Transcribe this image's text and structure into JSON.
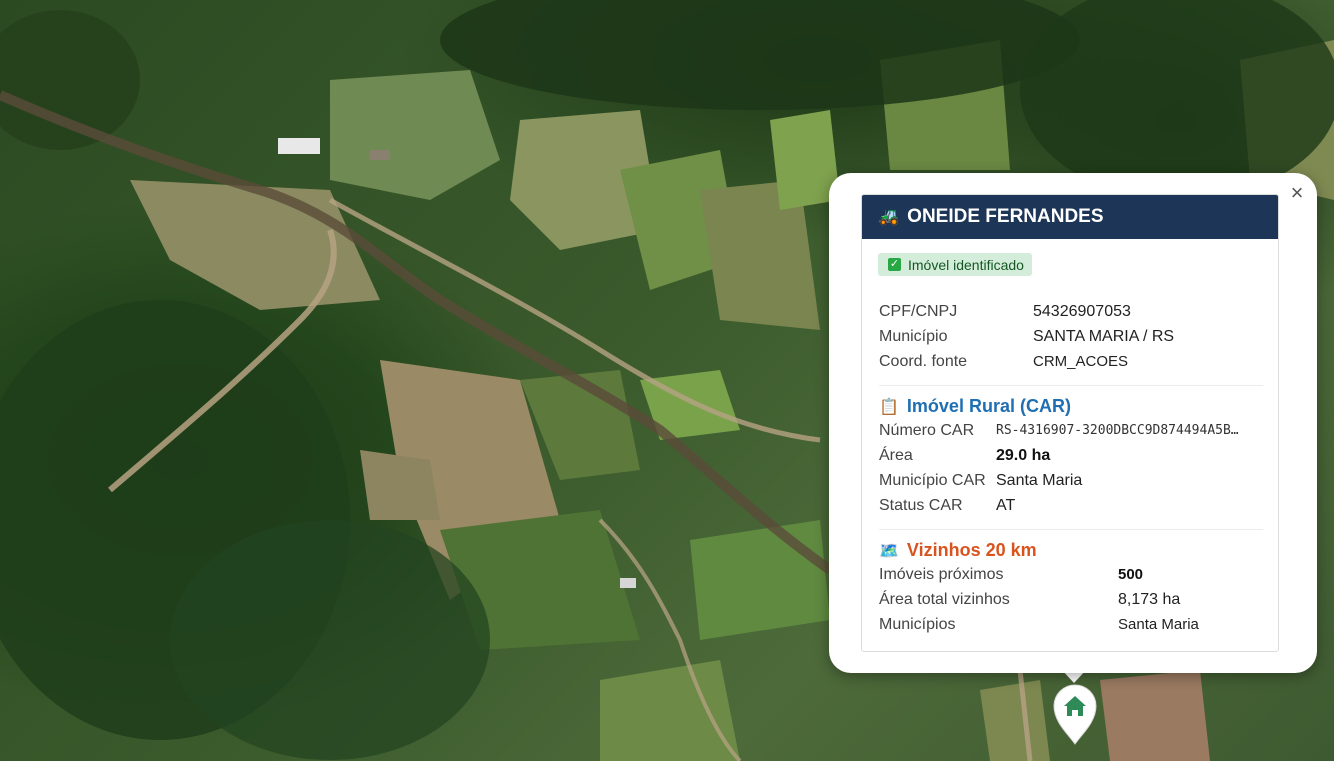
{
  "map": {
    "type": "satellite"
  },
  "popup": {
    "close_label": "×",
    "title": "ONEIDE FERNANDES",
    "title_icon": "tractor-icon",
    "badge": "Imóvel identificado",
    "owner": {
      "cpf_label": "CPF/CNPJ",
      "cpf_value": "54326907053",
      "municipio_label": "Município",
      "municipio_value": "SANTA MARIA / RS",
      "coord_label": "Coord. fonte",
      "coord_value": "CRM_ACOES"
    },
    "car": {
      "title": "Imóvel Rural (CAR)",
      "icon": "clipboard-icon",
      "numero_label": "Número CAR",
      "numero_value": "RS-4316907-3200DBCC9D874494A5B…",
      "area_label": "Área",
      "area_value": "29.0 ha",
      "municipio_label": "Município CAR",
      "municipio_value": "Santa Maria",
      "status_label": "Status CAR",
      "status_value": "AT"
    },
    "vizinhos": {
      "title": "Vizinhos 20 km",
      "icon": "map-icon",
      "proximos_label": "Imóveis próximos",
      "proximos_value": "500",
      "area_label": "Área total vizinhos",
      "area_value": "8,173 ha",
      "municipios_label": "Municípios",
      "municipios_value": "Santa Maria"
    }
  },
  "marker": {
    "icon": "home-icon",
    "color": "#2e8b57"
  }
}
